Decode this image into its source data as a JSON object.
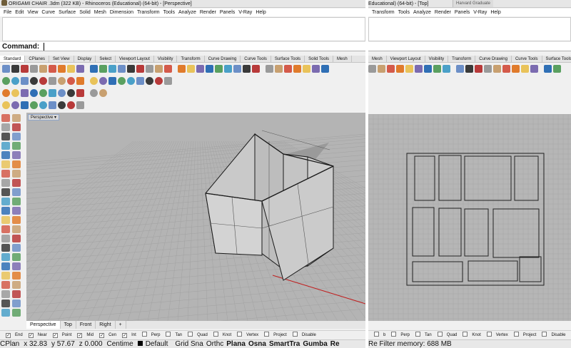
{
  "left_window": {
    "title": "ORIGAMI CHAIR .3dm (322 KB) - Rhinoceros (Educational) (64-bit) - [Perspective]",
    "menu": [
      "File",
      "Edit",
      "View",
      "Curve",
      "Surface",
      "Solid",
      "Mesh",
      "Dimension",
      "Transform",
      "Tools",
      "Analyze",
      "Render",
      "Panels",
      "V-Ray",
      "Help"
    ],
    "command_label": "Command:",
    "toolbar_tabs": [
      "Standard",
      "CPlanes",
      "Set View",
      "Display",
      "Select",
      "Viewport Layout",
      "Visibility",
      "Transform",
      "Curve Drawing",
      "Curve Tools",
      "Surface Tools",
      "Solid Tools",
      "Mesh"
    ],
    "active_toolbar_tab": "Standard",
    "viewport_label": "Perspective",
    "viewport_tabs": [
      "Perspective",
      "Top",
      "Front",
      "Right"
    ],
    "add_tab_icon": "plus-icon",
    "osnaps": [
      {
        "label": "End",
        "checked": true
      },
      {
        "label": "Near",
        "checked": true
      },
      {
        "label": "Point",
        "checked": true
      },
      {
        "label": "Mid",
        "checked": true
      },
      {
        "label": "Cen",
        "checked": true
      },
      {
        "label": "Int",
        "checked": true
      },
      {
        "label": "Perp",
        "checked": false
      },
      {
        "label": "Tan",
        "checked": false
      },
      {
        "label": "Quad",
        "checked": false
      },
      {
        "label": "Knot",
        "checked": false
      },
      {
        "label": "Vertex",
        "checked": false
      },
      {
        "label": "Project",
        "checked": false
      },
      {
        "label": "Disable",
        "checked": false
      }
    ],
    "status": {
      "cplane": "CPlan",
      "x": "x 32.83",
      "y": "y 57.67",
      "z": "z 0.000",
      "units": "Centime",
      "layer": "Default",
      "toggles": [
        "Grid Sna",
        "Orthc",
        "Plana",
        "Osna",
        "SmartTra",
        "Gumba",
        "Re"
      ]
    }
  },
  "right_window": {
    "title": "Educational) (64-bit) - [Top]",
    "tab_chip": "Harvard Graduate",
    "menu": [
      "Transform",
      "Tools",
      "Analyze",
      "Render",
      "Panels",
      "V-Ray",
      "Help"
    ],
    "toolbar_tabs": [
      "Mesh",
      "Viewport Layout",
      "Visibility",
      "Transform",
      "Curve Drawing",
      "Curve Tools",
      "Surface Tools"
    ],
    "osnaps": [
      {
        "label": "b",
        "checked": false
      },
      {
        "label": "Perp",
        "checked": false
      },
      {
        "label": "Tan",
        "checked": false
      },
      {
        "label": "Quad",
        "checked": false
      },
      {
        "label": "Knot",
        "checked": false
      },
      {
        "label": "Vertex",
        "checked": false
      },
      {
        "label": "Project",
        "checked": false
      },
      {
        "label": "Disable",
        "checked": false
      }
    ],
    "status_text": "Re Filter memory: 688 MB"
  },
  "colors": {
    "viewport_bg": "#b4b4b4",
    "grid_line": "#a2a2a2",
    "wall_face": "#cfcfcf",
    "edge": "#1a1a1a",
    "x_axis": "#c02020",
    "active_border": "#8fa5c8"
  }
}
